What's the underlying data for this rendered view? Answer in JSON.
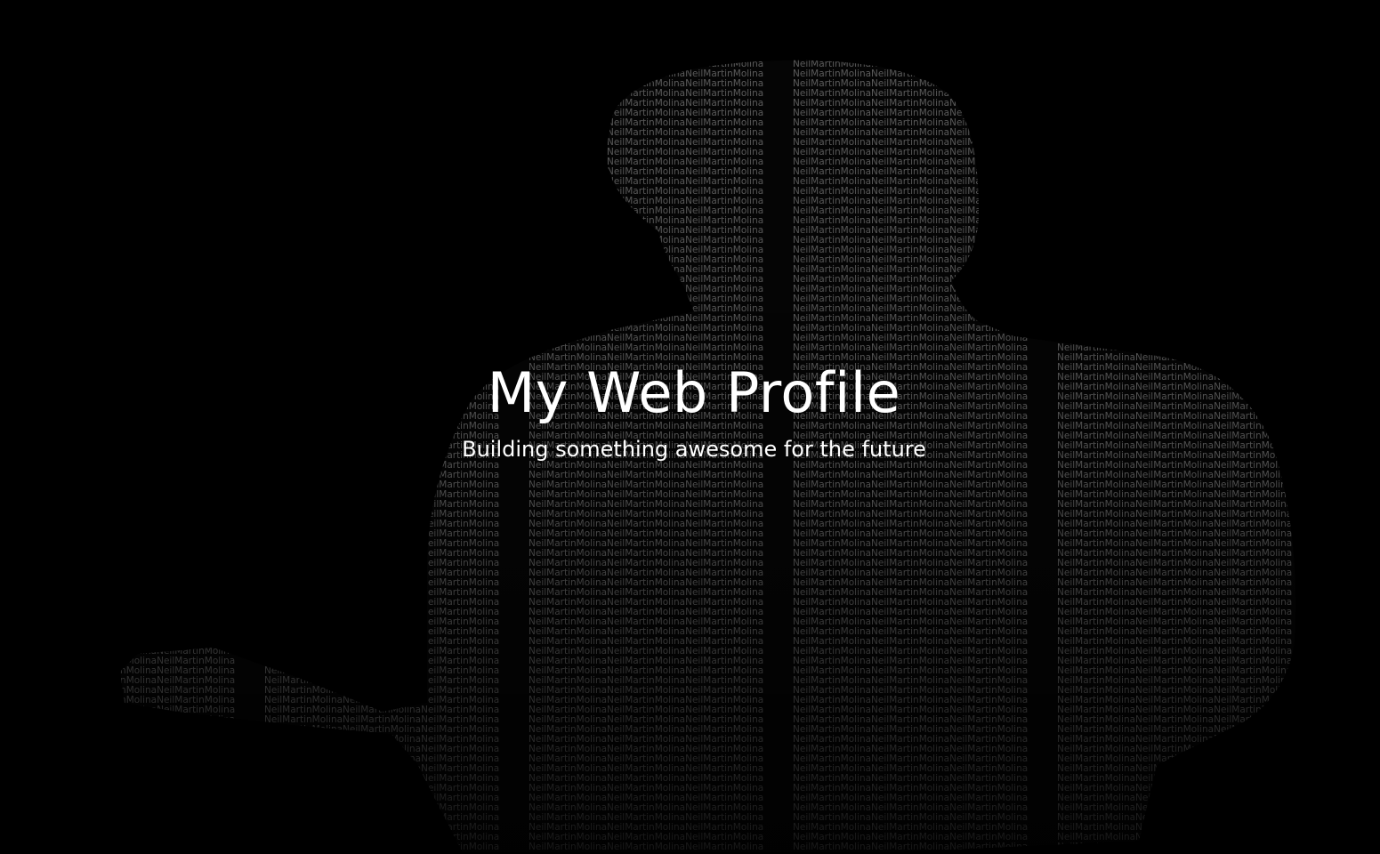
{
  "hero": {
    "title": "My Web Profile",
    "subtitle": "Building something awesome for the future",
    "background_pattern_text": "NeilMartinMolina"
  },
  "colors": {
    "background": "#000000",
    "text": "#ffffff",
    "pattern_text": "#7a7a7a"
  }
}
